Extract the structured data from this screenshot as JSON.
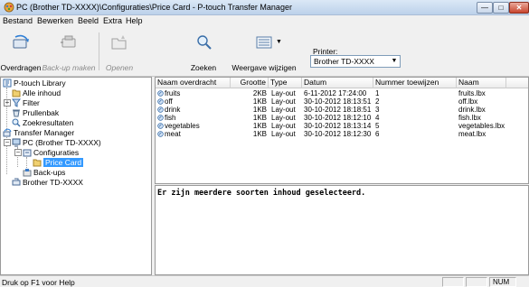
{
  "window": {
    "title": "PC (Brother TD-XXXX)\\Configuraties\\Price Card - P-touch Transfer Manager",
    "minimize_glyph": "—",
    "maximize_glyph": "□",
    "close_glyph": "✕"
  },
  "menu": [
    "Bestand",
    "Bewerken",
    "Beeld",
    "Extra",
    "Help"
  ],
  "toolbar": {
    "transfer_label": "Overdragen",
    "backup_label": "Back-up maken",
    "open_label": "Openen",
    "search_label": "Zoeken",
    "view_label": "Weergave wijzigen",
    "printer_label": "Printer:",
    "printer_value": "Brother TD-XXXX",
    "dropdown_arrow": "▼",
    "view_arrow": "▼"
  },
  "tree": {
    "library": "P-touch Library",
    "all_content": "Alle inhoud",
    "filter": "Filter",
    "recycle": "Prullenbak",
    "search_results": "Zoekresultaten",
    "transfer_manager": "Transfer Manager",
    "pc": "PC (Brother TD-XXXX)",
    "configurations": "Configuraties",
    "price_card": "Price Card",
    "backups": "Back-ups",
    "device": "Brother TD-XXXX",
    "minus": "−",
    "plus": "+"
  },
  "table": {
    "columns": [
      "Naam overdracht",
      "Grootte",
      "Type",
      "Datum",
      "Nummer toewijzen",
      "Naam"
    ],
    "rows": [
      [
        "fruits",
        "2KB",
        "Lay-out",
        "6-11-2012 17:24:00",
        "1",
        "fruits.lbx"
      ],
      [
        "off",
        "1KB",
        "Lay-out",
        "30-10-2012 18:13:51",
        "2",
        "off.lbx"
      ],
      [
        "drink",
        "1KB",
        "Lay-out",
        "30-10-2012 18:18:51",
        "3",
        "drink.lbx"
      ],
      [
        "fish",
        "1KB",
        "Lay-out",
        "30-10-2012 18:12:10",
        "4",
        "fish.lbx"
      ],
      [
        "vegetables",
        "1KB",
        "Lay-out",
        "30-10-2012 18:13:14",
        "5",
        "vegetables.lbx"
      ],
      [
        "meat",
        "1KB",
        "Lay-out",
        "30-10-2012 18:12:30",
        "6",
        "meat.lbx"
      ]
    ]
  },
  "preview": {
    "message": "Er zijn meerdere soorten inhoud geselecteerd."
  },
  "status": {
    "help_text": "Druk op F1 voor Help",
    "num": "NUM"
  },
  "colors": {
    "selection": "#3399ff",
    "titlebar": "#c6d9f0"
  }
}
